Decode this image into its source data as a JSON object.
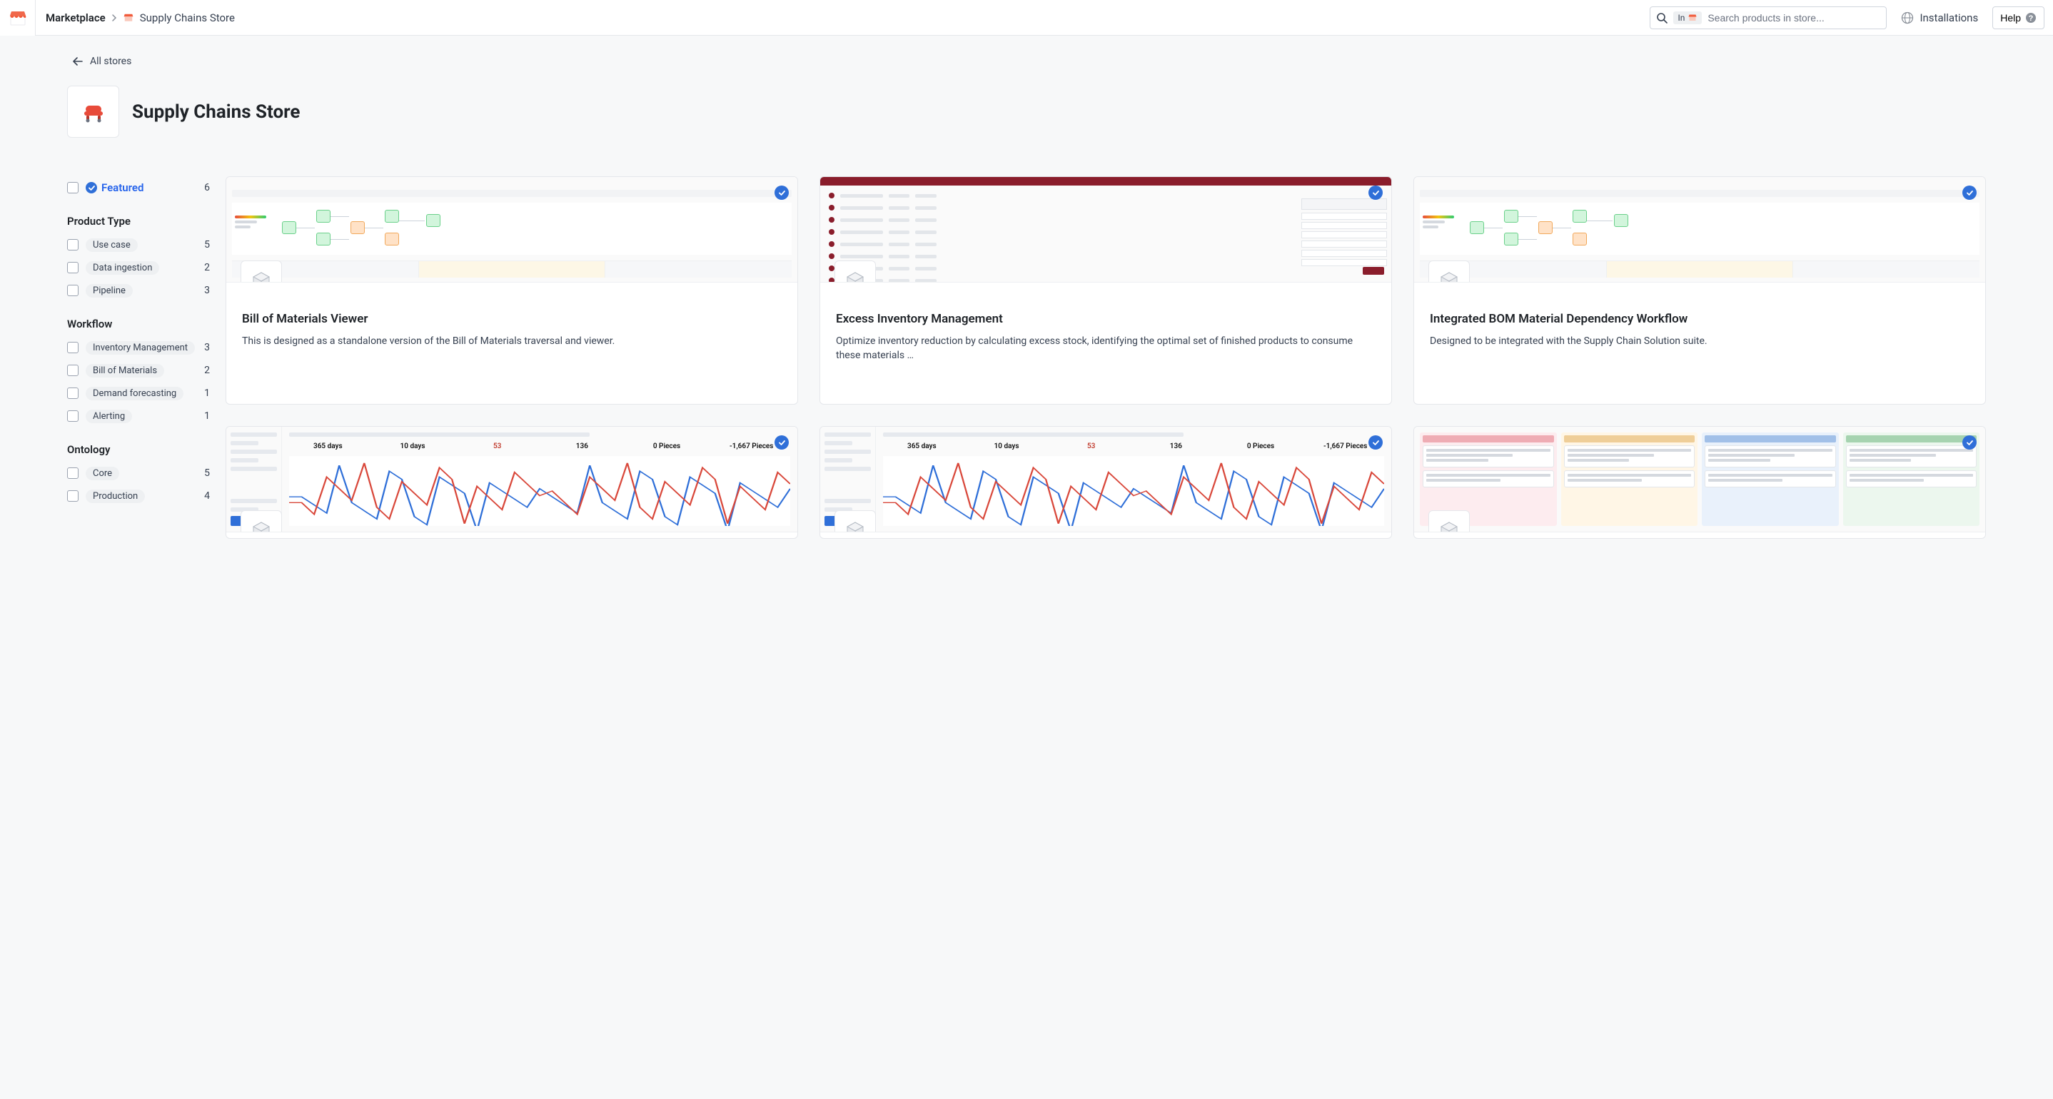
{
  "header": {
    "breadcrumb_root": "Marketplace",
    "breadcrumb_leaf": "Supply Chains Store",
    "search_in_label": "In",
    "search_placeholder": "Search products in store...",
    "installations_label": "Installations",
    "help_label": "Help"
  },
  "back_link": "All stores",
  "store_title": "Supply Chains Store",
  "filters": {
    "featured": {
      "label": "Featured",
      "count": "6"
    },
    "groups": [
      {
        "title": "Product Type",
        "items": [
          {
            "label": "Use case",
            "count": "5"
          },
          {
            "label": "Data ingestion",
            "count": "2"
          },
          {
            "label": "Pipeline",
            "count": "3"
          }
        ]
      },
      {
        "title": "Workflow",
        "items": [
          {
            "label": "Inventory Management",
            "count": "3"
          },
          {
            "label": "Bill of Materials",
            "count": "2"
          },
          {
            "label": "Demand forecasting",
            "count": "1"
          },
          {
            "label": "Alerting",
            "count": "1"
          }
        ]
      },
      {
        "title": "Ontology",
        "items": [
          {
            "label": "Core",
            "count": "5"
          },
          {
            "label": "Production",
            "count": "4"
          }
        ]
      }
    ]
  },
  "cards": [
    {
      "title": "Bill of Materials Viewer",
      "desc": "This is designed as a standalone version of the Bill of Materials traversal and viewer.",
      "thumb": "flow"
    },
    {
      "title": "Excess Inventory Management",
      "desc": "Optimize inventory reduction by calculating excess stock, identifying the optimal set of finished products to consume these materials …",
      "thumb": "table"
    },
    {
      "title": "Integrated BOM Material Dependency Workflow",
      "desc": "Designed to be integrated with the Supply Chain Solution suite.",
      "thumb": "flow"
    },
    {
      "title": "",
      "desc": "",
      "thumb": "dash"
    },
    {
      "title": "",
      "desc": "",
      "thumb": "dash"
    },
    {
      "title": "",
      "desc": "",
      "thumb": "kanban"
    }
  ],
  "colors": {
    "accent": "#2f6fd8",
    "maroon": "#8a1d2b"
  }
}
